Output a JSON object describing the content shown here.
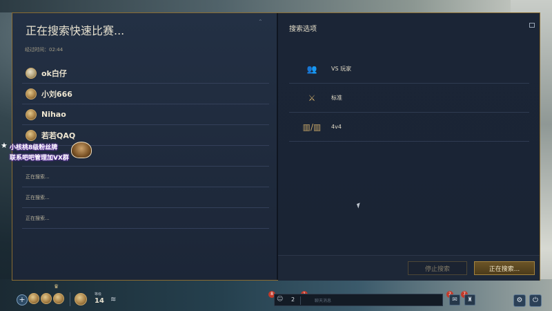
{
  "left_panel": {
    "title": "正在搜索快速比赛...",
    "elapsed": "经过时间：02:44",
    "players": [
      {
        "name": "ok白仔"
      },
      {
        "name": "小刘666"
      },
      {
        "name": "Nihao"
      },
      {
        "name": "若若QAQ"
      }
    ],
    "empty_slots": [
      "正在搜索...",
      "正在搜索...",
      "正在搜索..."
    ],
    "overlay": {
      "line1": "小核桃8级粉丝牌",
      "line2": "联系吧吧管理加VX群"
    }
  },
  "right_panel": {
    "title": "搜索选项",
    "options": [
      {
        "icon": "team-icon",
        "label": "VS 玩家"
      },
      {
        "icon": "crossed-swords-icon",
        "label": "标准"
      },
      {
        "icon": "teams-vs-icon",
        "label": "4v4"
      }
    ],
    "stop_button": "停止搜索",
    "searching_button": "正在搜索..."
  },
  "hud": {
    "level_label": "等级",
    "level": "14",
    "chat_count": "2",
    "chat_placeholder": "聊天消息",
    "chat_badge": "8",
    "chat_badge2": "1",
    "notif_badge1": "2",
    "notif_badge2": "7"
  },
  "colors": {
    "accent_gold": "#a5843f",
    "panel_bg": "#1d2838",
    "badge_red": "#c23a2a"
  }
}
